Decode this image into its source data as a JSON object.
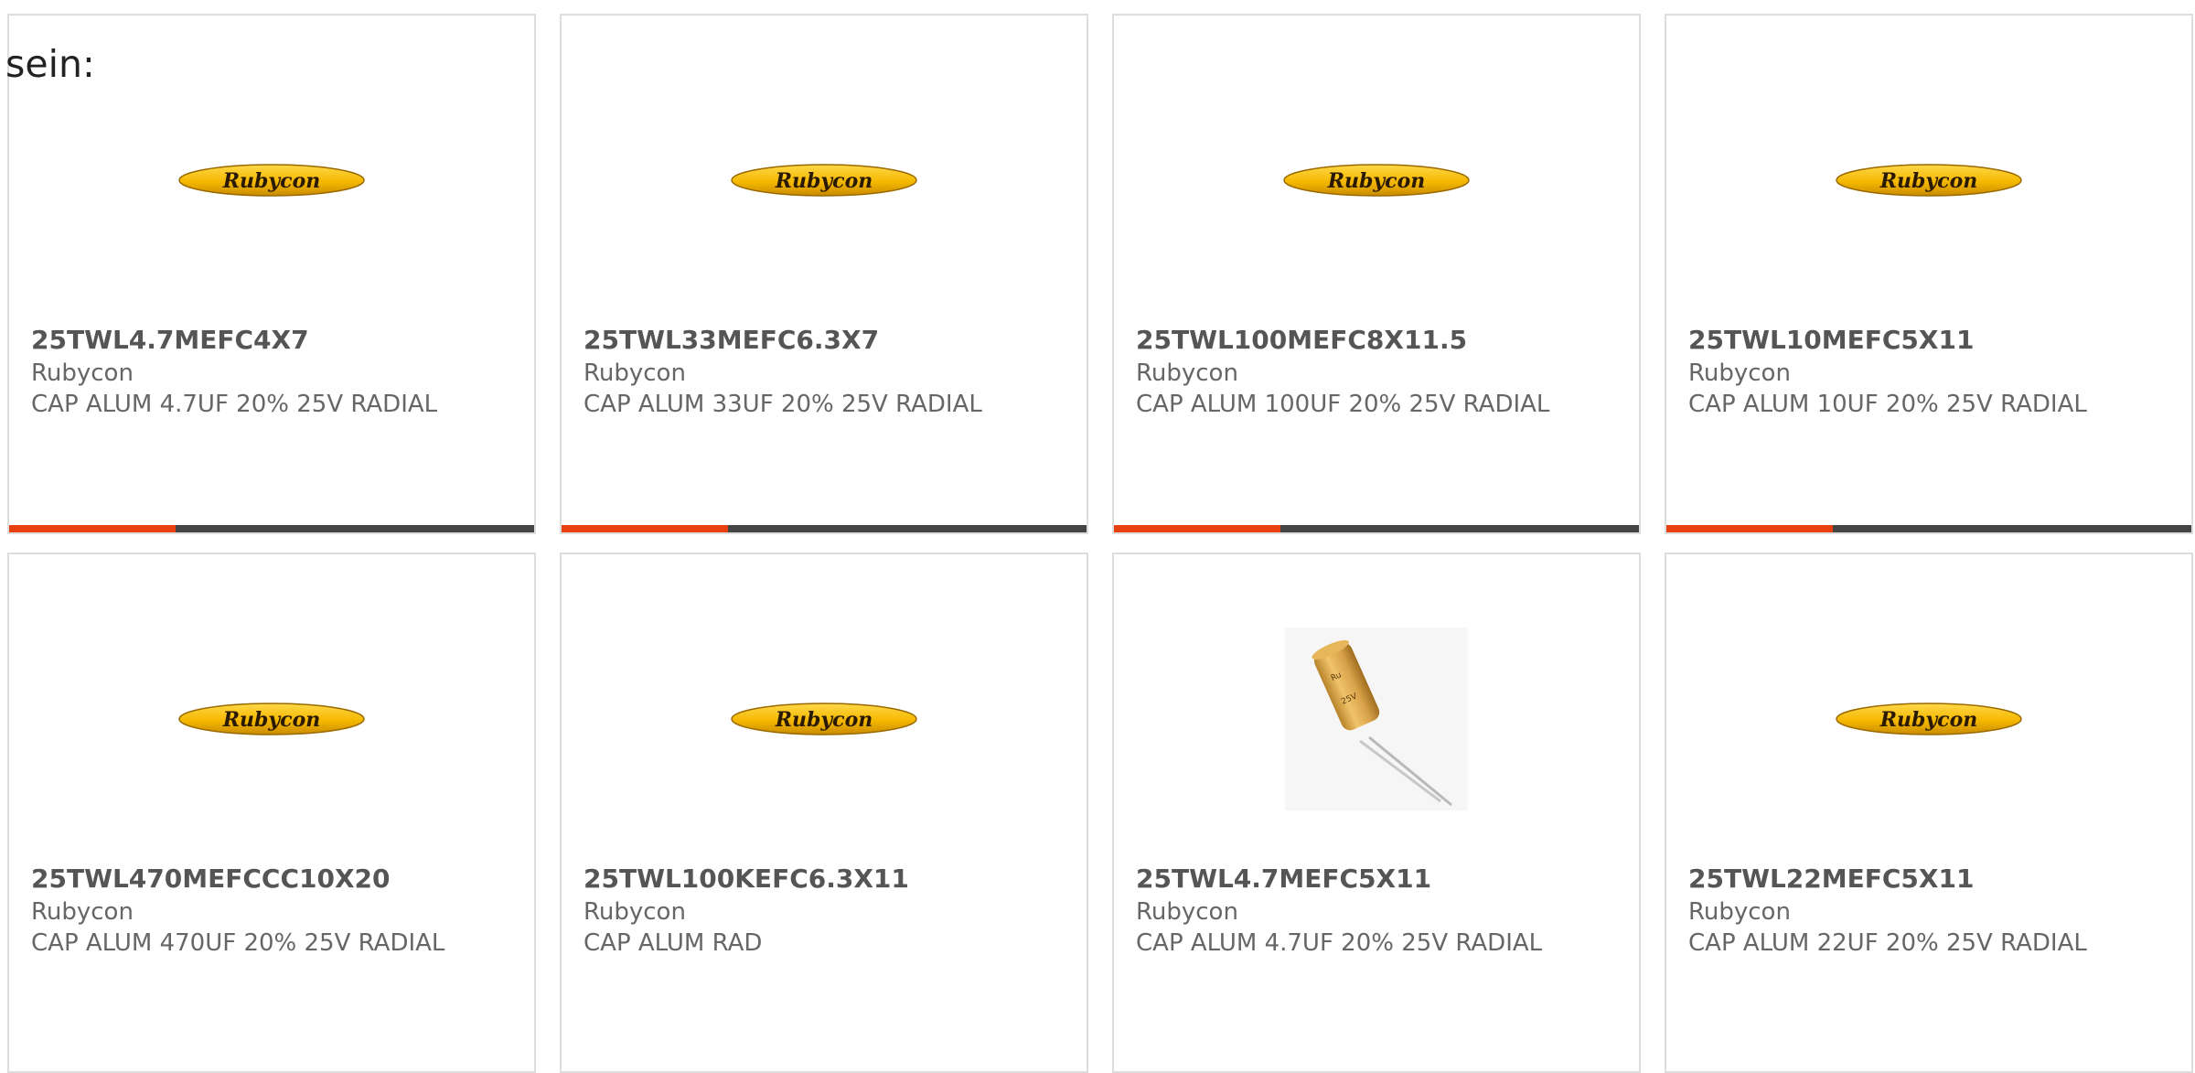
{
  "intro_text": "sein:",
  "colors": {
    "accent": "#e8410f",
    "bar": "#444444",
    "border": "#dddddd",
    "logo_yellow": "#f5b800"
  },
  "products": [
    {
      "part_number": "25TWL4.7MEFC4X7",
      "manufacturer": "Rubycon",
      "description": "CAP ALUM 4.7UF 20% 25V RADIAL",
      "image": "rubycon-logo"
    },
    {
      "part_number": "25TWL33MEFC6.3X7",
      "manufacturer": "Rubycon",
      "description": "CAP ALUM 33UF 20% 25V RADIAL",
      "image": "rubycon-logo"
    },
    {
      "part_number": "25TWL100MEFC8X11.5",
      "manufacturer": "Rubycon",
      "description": "CAP ALUM 100UF 20% 25V RADIAL",
      "image": "rubycon-logo"
    },
    {
      "part_number": "25TWL10MEFC5X11",
      "manufacturer": "Rubycon",
      "description": "CAP ALUM 10UF 20% 25V RADIAL",
      "image": "rubycon-logo"
    },
    {
      "part_number": "25TWL470MEFCCC10X20",
      "manufacturer": "Rubycon",
      "description": "CAP ALUM 470UF 20% 25V RADIAL",
      "image": "rubycon-logo"
    },
    {
      "part_number": "25TWL100KEFC6.3X11",
      "manufacturer": "Rubycon",
      "description": "CAP ALUM RAD",
      "image": "rubycon-logo"
    },
    {
      "part_number": "25TWL4.7MEFC5X11",
      "manufacturer": "Rubycon",
      "description": "CAP ALUM 4.7UF 20% 25V RADIAL",
      "image": "capacitor-photo"
    },
    {
      "part_number": "25TWL22MEFC5X11",
      "manufacturer": "Rubycon",
      "description": "CAP ALUM 22UF 20% 25V RADIAL",
      "image": "rubycon-logo"
    }
  ]
}
